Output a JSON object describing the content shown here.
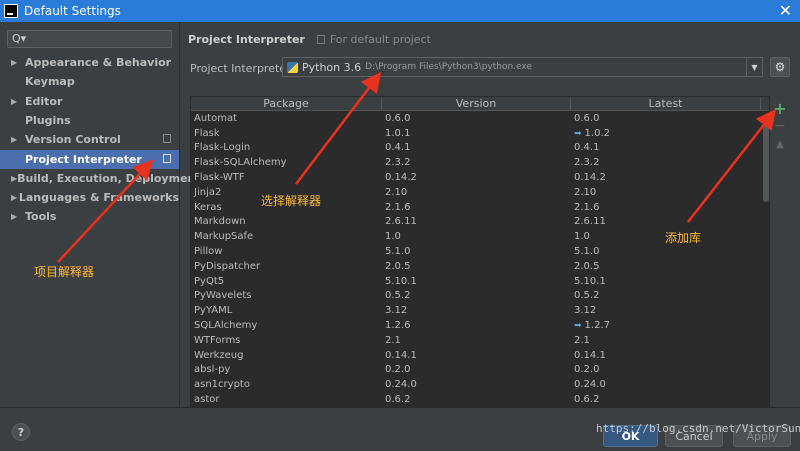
{
  "window": {
    "title": "Default Settings"
  },
  "sidebar": {
    "search_placeholder": "Q▾",
    "items": [
      {
        "label": "Appearance & Behavior",
        "arrow": "▶",
        "copy": false
      },
      {
        "label": "Keymap",
        "arrow": "",
        "copy": false
      },
      {
        "label": "Editor",
        "arrow": "▶",
        "copy": false
      },
      {
        "label": "Plugins",
        "arrow": "",
        "copy": false
      },
      {
        "label": "Version Control",
        "arrow": "▶",
        "copy": true
      },
      {
        "label": "Project Interpreter",
        "arrow": "",
        "copy": true,
        "selected": true
      },
      {
        "label": "Build, Execution, Deployment",
        "arrow": "▶",
        "copy": false
      },
      {
        "label": "Languages & Frameworks",
        "arrow": "▶",
        "copy": false
      },
      {
        "label": "Tools",
        "arrow": "▶",
        "copy": false
      }
    ]
  },
  "main": {
    "breadcrumb": "Project Interpreter",
    "breadcrumb_sub": "For default project",
    "interpreter_label": "Project Interpreter:",
    "interpreter_name": "Python 3.6",
    "interpreter_path": "D:\\Program Files\\Python3\\python.exe"
  },
  "table": {
    "headers": [
      "Package",
      "Version",
      "Latest"
    ],
    "rows": [
      {
        "package": "Automat",
        "version": "0.6.0",
        "latest": "0.6.0",
        "upgrade": false
      },
      {
        "package": "Flask",
        "version": "1.0.1",
        "latest": "1.0.2",
        "upgrade": true
      },
      {
        "package": "Flask-Login",
        "version": "0.4.1",
        "latest": "0.4.1",
        "upgrade": false
      },
      {
        "package": "Flask-SQLAlchemy",
        "version": "2.3.2",
        "latest": "2.3.2",
        "upgrade": false
      },
      {
        "package": "Flask-WTF",
        "version": "0.14.2",
        "latest": "0.14.2",
        "upgrade": false
      },
      {
        "package": "Jinja2",
        "version": "2.10",
        "latest": "2.10",
        "upgrade": false
      },
      {
        "package": "Keras",
        "version": "2.1.6",
        "latest": "2.1.6",
        "upgrade": false
      },
      {
        "package": "Markdown",
        "version": "2.6.11",
        "latest": "2.6.11",
        "upgrade": false
      },
      {
        "package": "MarkupSafe",
        "version": "1.0",
        "latest": "1.0",
        "upgrade": false
      },
      {
        "package": "Pillow",
        "version": "5.1.0",
        "latest": "5.1.0",
        "upgrade": false
      },
      {
        "package": "PyDispatcher",
        "version": "2.0.5",
        "latest": "2.0.5",
        "upgrade": false
      },
      {
        "package": "PyQt5",
        "version": "5.10.1",
        "latest": "5.10.1",
        "upgrade": false
      },
      {
        "package": "PyWavelets",
        "version": "0.5.2",
        "latest": "0.5.2",
        "upgrade": false
      },
      {
        "package": "PyYAML",
        "version": "3.12",
        "latest": "3.12",
        "upgrade": false
      },
      {
        "package": "SQLAlchemy",
        "version": "1.2.6",
        "latest": "1.2.7",
        "upgrade": true
      },
      {
        "package": "WTForms",
        "version": "2.1",
        "latest": "2.1",
        "upgrade": false
      },
      {
        "package": "Werkzeug",
        "version": "0.14.1",
        "latest": "0.14.1",
        "upgrade": false
      },
      {
        "package": "absl-py",
        "version": "0.2.0",
        "latest": "0.2.0",
        "upgrade": false
      },
      {
        "package": "asn1crypto",
        "version": "0.24.0",
        "latest": "0.24.0",
        "upgrade": false
      },
      {
        "package": "astor",
        "version": "0.6.2",
        "latest": "0.6.2",
        "upgrade": false
      }
    ]
  },
  "side_buttons": {
    "add": "+",
    "remove": "−",
    "up": "▲"
  },
  "footer": {
    "help": "?",
    "ok": "OK",
    "cancel": "Cancel",
    "apply": "Apply"
  },
  "annotations": {
    "sidebar_note": "项目解释器",
    "select_note": "选择解释器",
    "add_note": "添加库",
    "arrow_color": "#e8321e",
    "text_color": "#ffb732"
  },
  "watermark": "https://blog.csdn.net/VictorSun"
}
